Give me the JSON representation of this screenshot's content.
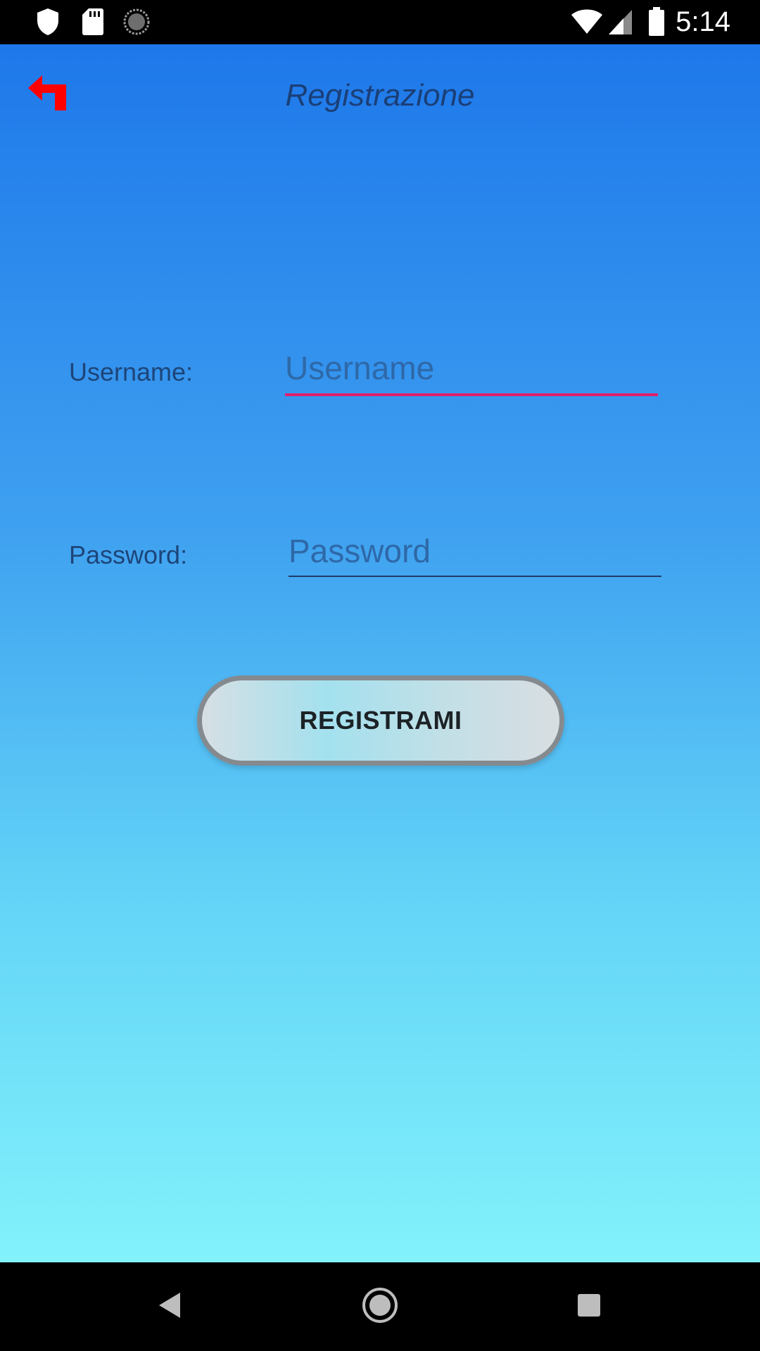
{
  "status_bar": {
    "time": "5:14",
    "icons": [
      "shield-icon",
      "sd-card-icon",
      "loading-circle-icon",
      "wifi-icon",
      "signal-icon",
      "battery-icon"
    ]
  },
  "header": {
    "title": "Registrazione",
    "back_icon": "back-arrow-icon"
  },
  "form": {
    "username": {
      "label": "Username:",
      "placeholder": "Username",
      "value": ""
    },
    "password": {
      "label": "Password:",
      "placeholder": "Password",
      "value": ""
    },
    "submit_label": "REGISTRAMI"
  },
  "colors": {
    "back_arrow": "#ff0000",
    "focused_underline": "#e0206a",
    "unfocused_underline": "#1f3d66",
    "gradient_top": "#1e78ea",
    "gradient_bottom": "#82f2fb"
  },
  "nav_bar": {
    "buttons": [
      "back-triangle-icon",
      "home-circle-icon",
      "recents-square-icon"
    ]
  }
}
